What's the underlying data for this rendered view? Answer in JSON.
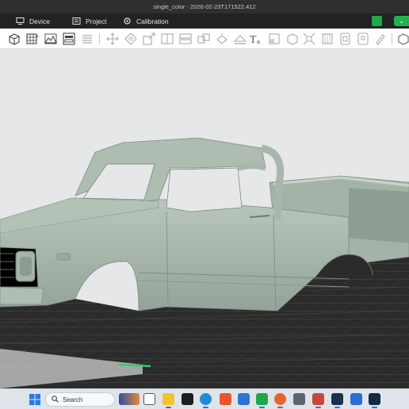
{
  "window": {
    "title": "single_color - 2026-02-23T171522.412"
  },
  "menu": {
    "items": [
      {
        "label": "Device",
        "icon": "monitor-icon"
      },
      {
        "label": "Project",
        "icon": "project-icon"
      },
      {
        "label": "Calibration",
        "icon": "calibration-icon"
      }
    ],
    "right_icons": [
      "green-app-icon",
      "green-status-button"
    ]
  },
  "toolbar": {
    "tools": [
      "add-cube-icon",
      "add-grid-icon",
      "import-icon",
      "plate-icon",
      "list-icon",
      "move-icon",
      "rotate-icon",
      "scale-icon",
      "split-icon",
      "arrange-icon",
      "orient-icon",
      "auto-orient-icon",
      "place-face-icon",
      "cut-icon",
      "text-icon",
      "support-icon",
      "measure-icon",
      "assembly-icon",
      "slice-view-icon",
      "variable-layer-icon",
      "seam-icon",
      "brim-icon",
      "paint-icon"
    ]
  },
  "taskbar": {
    "search_label": "Search",
    "apps": [
      "start-icon",
      "search-icon",
      "widgets-icon",
      "task-view-icon",
      "file-explorer-icon",
      "terminal-icon",
      "edge-browser-icon",
      "office-icon",
      "store-icon",
      "slicer-app-icon",
      "firefox-icon",
      "calculator-icon",
      "paint-app-icon",
      "photo-app-icon",
      "settings-icon",
      "design-app-icon",
      "cad-app-icon"
    ]
  },
  "colors": {
    "titlebar_bg": "#2f2f30",
    "menubar_bg": "#222223",
    "accent_green": "#21b24f",
    "model_color": "#a9b7ad",
    "bed_color": "#2a2a2a",
    "viewport_bg": "#e6e7e8"
  }
}
